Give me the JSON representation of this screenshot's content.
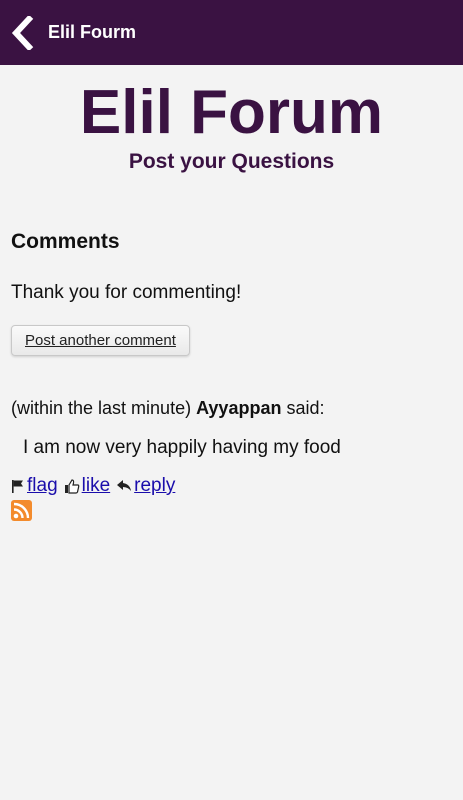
{
  "appbar": {
    "title": "Elil Fourm"
  },
  "header": {
    "title": "Elil Forum",
    "subtitle": "Post your Questions"
  },
  "comments": {
    "heading": "Comments",
    "thanks": "Thank you for commenting!",
    "post_another_label": "Post another comment",
    "items": [
      {
        "time": "(within the last minute)",
        "author": "Ayyappan",
        "said": "said:",
        "text": "I am now very happily having my food",
        "actions": {
          "flag": "flag",
          "like": "like",
          "reply": "reply"
        }
      }
    ]
  },
  "icons": {
    "back": "chevron-left-icon",
    "flag": "flag-icon",
    "like": "thumbs-up-icon",
    "reply": "reply-arrow-icon",
    "rss": "rss-feed-icon"
  },
  "colors": {
    "appbar": "#3a1242",
    "title": "#3a1242",
    "link": "#1a0dab",
    "rss": "#f38b2c"
  }
}
